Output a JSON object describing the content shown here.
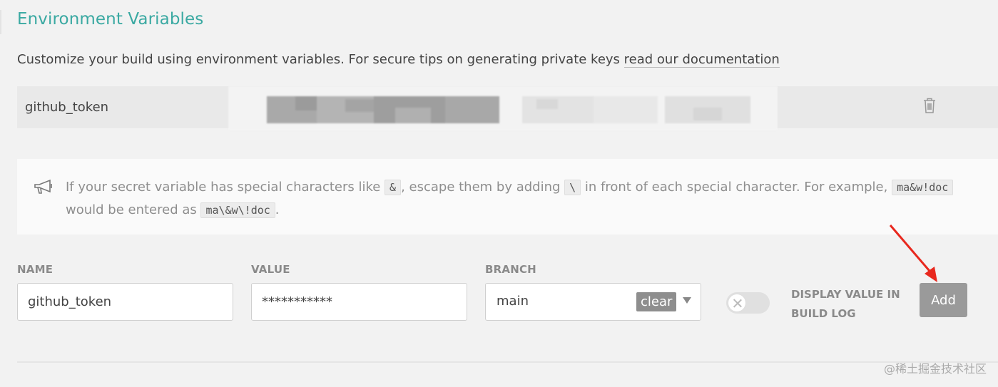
{
  "section": {
    "title": "Environment Variables",
    "description_prefix": "Customize your build using environment variables. For secure tips on generating private keys ",
    "description_link": "read our documentation"
  },
  "env_row": {
    "name": "github_token",
    "delete_icon": "trash-icon"
  },
  "notice": {
    "icon": "megaphone-icon",
    "text_1": "If your secret variable has special characters like ",
    "code_1": "&",
    "text_2": ", escape them by adding ",
    "code_2": "\\",
    "text_3": " in front of each special character. For example, ",
    "code_3": "ma&w!doc",
    "text_4": " would be entered as ",
    "code_4": "ma\\&w\\!doc",
    "text_5": "."
  },
  "form": {
    "name_label": "NAME",
    "name_value": "github_token",
    "value_label": "VALUE",
    "value_value": "***********",
    "branch_label": "BRANCH",
    "branch_value": "main",
    "clear_label": "clear",
    "toggle_label": "DISPLAY VALUE IN BUILD LOG",
    "toggle_on": false,
    "add_label": "Add"
  },
  "watermark": "@稀土掘金技术社区",
  "colors": {
    "title": "#3aa9a2",
    "add_button": "#9a9a9a",
    "annotation_arrow": "#e8281e"
  }
}
